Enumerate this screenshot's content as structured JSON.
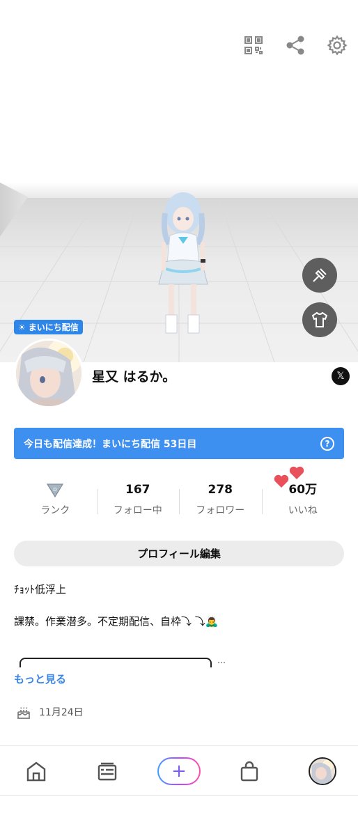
{
  "hero": {
    "daily_badge": "まいにち配信",
    "top_icons": [
      "qr-code-icon",
      "share-icon",
      "settings-gear-icon"
    ],
    "side_buttons": [
      "brush-edit-icon",
      "tshirt-icon"
    ]
  },
  "profile": {
    "name": "星又 はるか。",
    "social_link_icon": "x-logo-icon",
    "social_link_glyph": "𝕏"
  },
  "streak": {
    "text": "今日も配信達成！まいにち配信 53日目",
    "help_glyph": "?"
  },
  "stats": {
    "rank": {
      "label": "ランク",
      "icon": "rank-triangle-icon"
    },
    "following": {
      "value": "167",
      "label": "フォロー中"
    },
    "followers": {
      "value": "278",
      "label": "フォロワー"
    },
    "likes": {
      "value": "60万",
      "label": "いいね"
    }
  },
  "edit_profile_label": "プロフィール編集",
  "bio": {
    "line1": "ﾁｮｯﾄ低浮上",
    "line2": "課禁。作業潜多。不定期配信、自枠⤵︎ ⤵︎🙇‍♂️",
    "ellipsis": "…"
  },
  "more_label": "もっと見る",
  "birthday": "11月24日",
  "nav": {
    "items": [
      "home-icon",
      "feed-list-icon",
      "plus-icon",
      "shop-bag-icon",
      "profile-avatar"
    ],
    "plus_glyph": "+"
  },
  "colors": {
    "accent_blue": "#3d8ff0",
    "badge_blue": "#2e86e8",
    "link_blue": "#3a86e6",
    "heart_red": "#e8505b"
  }
}
